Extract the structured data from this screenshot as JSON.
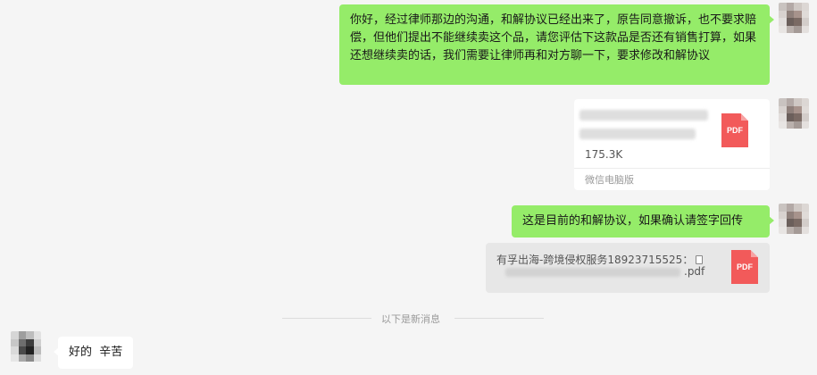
{
  "messages": {
    "msg1_text": "你好，经过律师那边的沟通，和解协议已经出来了，原告同意撤诉，也不要求赔偿，但他们提出不能继续卖这个品，请您评估下这款品是否还有销售打算，如果还想继续卖的话，我们需要让律师再和对方聊一下，要求修改和解协议",
    "file1_size": "175.3K",
    "file1_source": "微信电脑版",
    "file1_icon_label": "PDF",
    "msg2_text": "这是目前的和解协议，如果确认请签字回传",
    "file2_name_line1": "有孚出海-跨境侵权服务18923715525：",
    "file2_name_suffix": ".pdf",
    "file2_icon_label": "PDF",
    "divider_text": "以下是新消息",
    "msg3_text": "好的  辛苦"
  },
  "colors": {
    "chat_bg": "#f5f5f5",
    "my_bubble": "#95ec69",
    "other_bubble": "#ffffff",
    "pdf_red": "#f25a5a"
  }
}
